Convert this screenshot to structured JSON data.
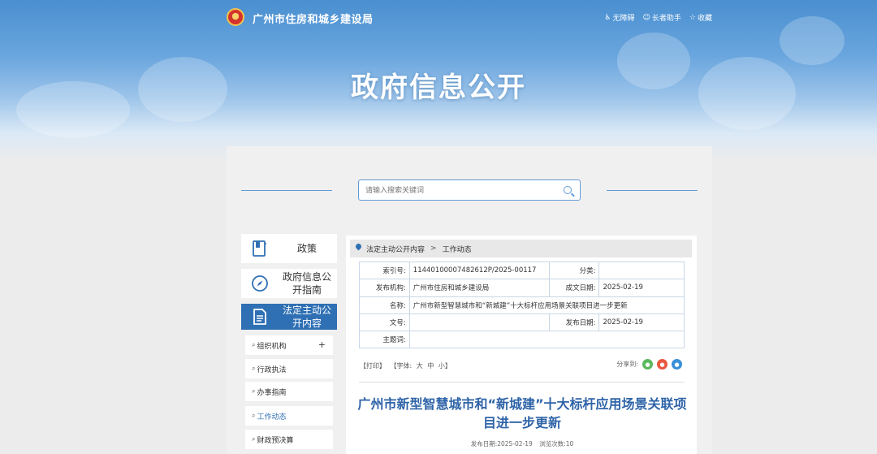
{
  "header": {
    "site_title": "广州市住房和城乡建设局",
    "links": [
      {
        "label": "无障碍",
        "icon": "accessibility-icon"
      },
      {
        "label": "长者助手",
        "icon": "elder-assist-icon"
      },
      {
        "label": "收藏",
        "icon": "star-icon"
      }
    ],
    "hero_title": "政府信息公开"
  },
  "search": {
    "placeholder": "请输入搜索关键词"
  },
  "sidebar": {
    "main_items": [
      {
        "label": "政策",
        "icon": "book-icon"
      },
      {
        "label": "政府信息公开指南",
        "icon": "compass-icon"
      },
      {
        "label": "法定主动公开内容",
        "icon": "document-icon",
        "active": true
      }
    ],
    "sub_items": [
      {
        "label": "组织机构",
        "expandable": "+"
      },
      {
        "label": "行政执法"
      },
      {
        "label": "办事指南"
      },
      {
        "label": "工作动态",
        "current": true
      },
      {
        "label": "财政预决算"
      }
    ]
  },
  "breadcrumb": {
    "items": [
      "法定主动公开内容",
      "工作动态"
    ],
    "separator": ">"
  },
  "meta": {
    "index_label": "索引号:",
    "index_value": "11440100007482612P/2025-00117",
    "category_label": "分类:",
    "category_value": "",
    "publisher_label": "发布机构:",
    "publisher_value": "广州市住房和城乡建设局",
    "created_label": "成文日期:",
    "created_value": "2025-02-19",
    "name_label": "名称:",
    "name_value": "广州市新型智慧城市和“新城建”十大标杆应用场景关联项目进一步更新",
    "docno_label": "文号:",
    "docno_value": "",
    "published_label": "发布日期:",
    "published_value": "2025-02-19",
    "subject_label": "主题词:",
    "subject_value": ""
  },
  "tools": {
    "print": "【打印】",
    "font_prefix": "【字体:",
    "font_large": "大",
    "font_medium": "中",
    "font_small": "小】",
    "share_label": "分享到:"
  },
  "article": {
    "title": "广州市新型智慧城市和“新城建”十大标杆应用场景关联项目进一步更新",
    "publish_date": "发布日期:2025-02-19",
    "views": "浏览次数:10"
  },
  "colors": {
    "primary": "#2f70b4",
    "title": "#2f64a8",
    "border": "#c9d7e6"
  }
}
